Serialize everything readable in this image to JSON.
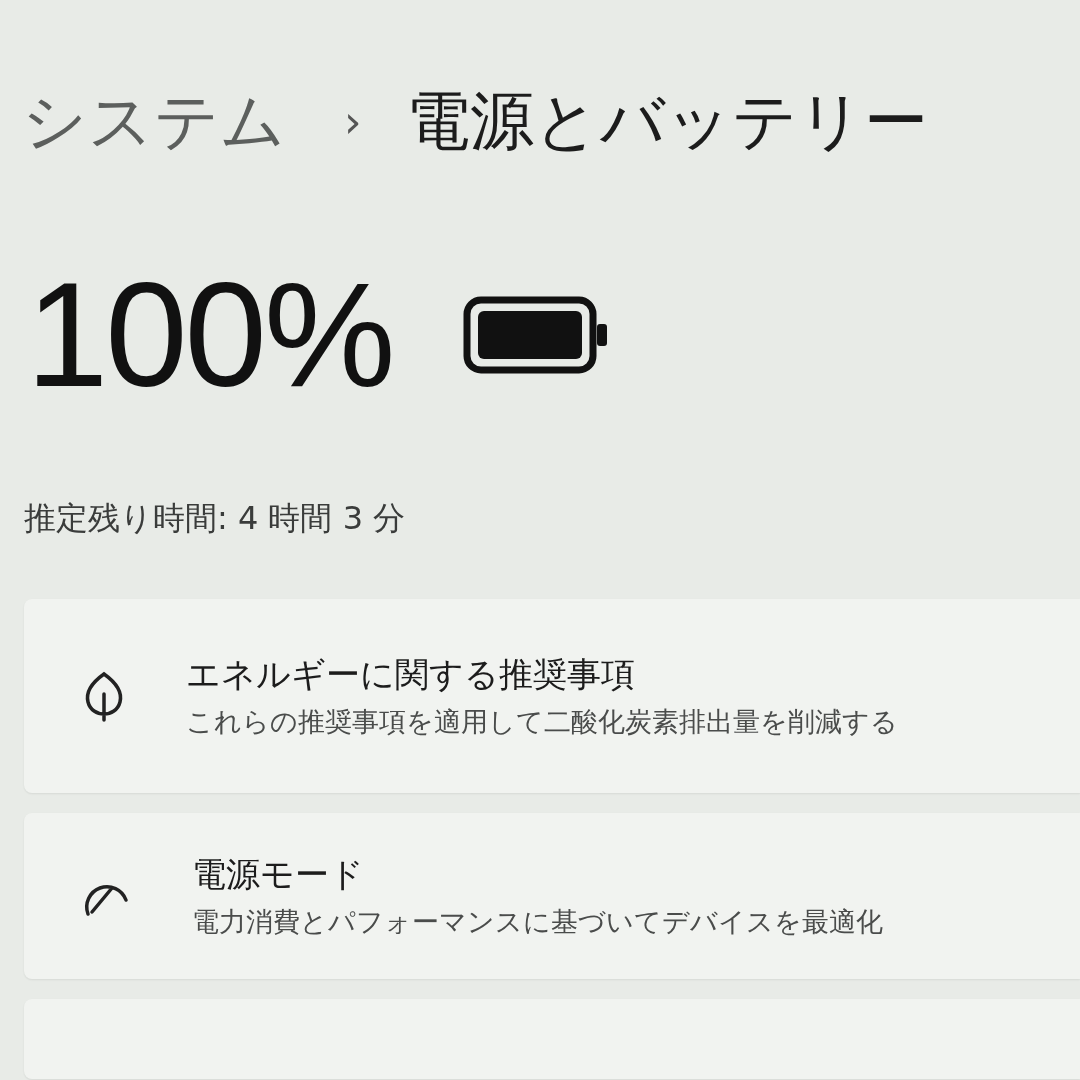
{
  "breadcrumb": {
    "parent": "システム",
    "separator": "›",
    "current": "電源とバッテリー"
  },
  "battery": {
    "percent": "100%"
  },
  "estimate": "推定残り時間: 4 時間 3 分",
  "cards": [
    {
      "kind": "leaf",
      "title": "エネルギーに関する推奨事項",
      "subtitle": "これらの推奨事項を適用して二酸化炭素排出量を削減する"
    },
    {
      "kind": "gauge",
      "title": "電源モード",
      "subtitle": "電力消費とパフォーマンスに基づいてデバイスを最適化"
    }
  ]
}
